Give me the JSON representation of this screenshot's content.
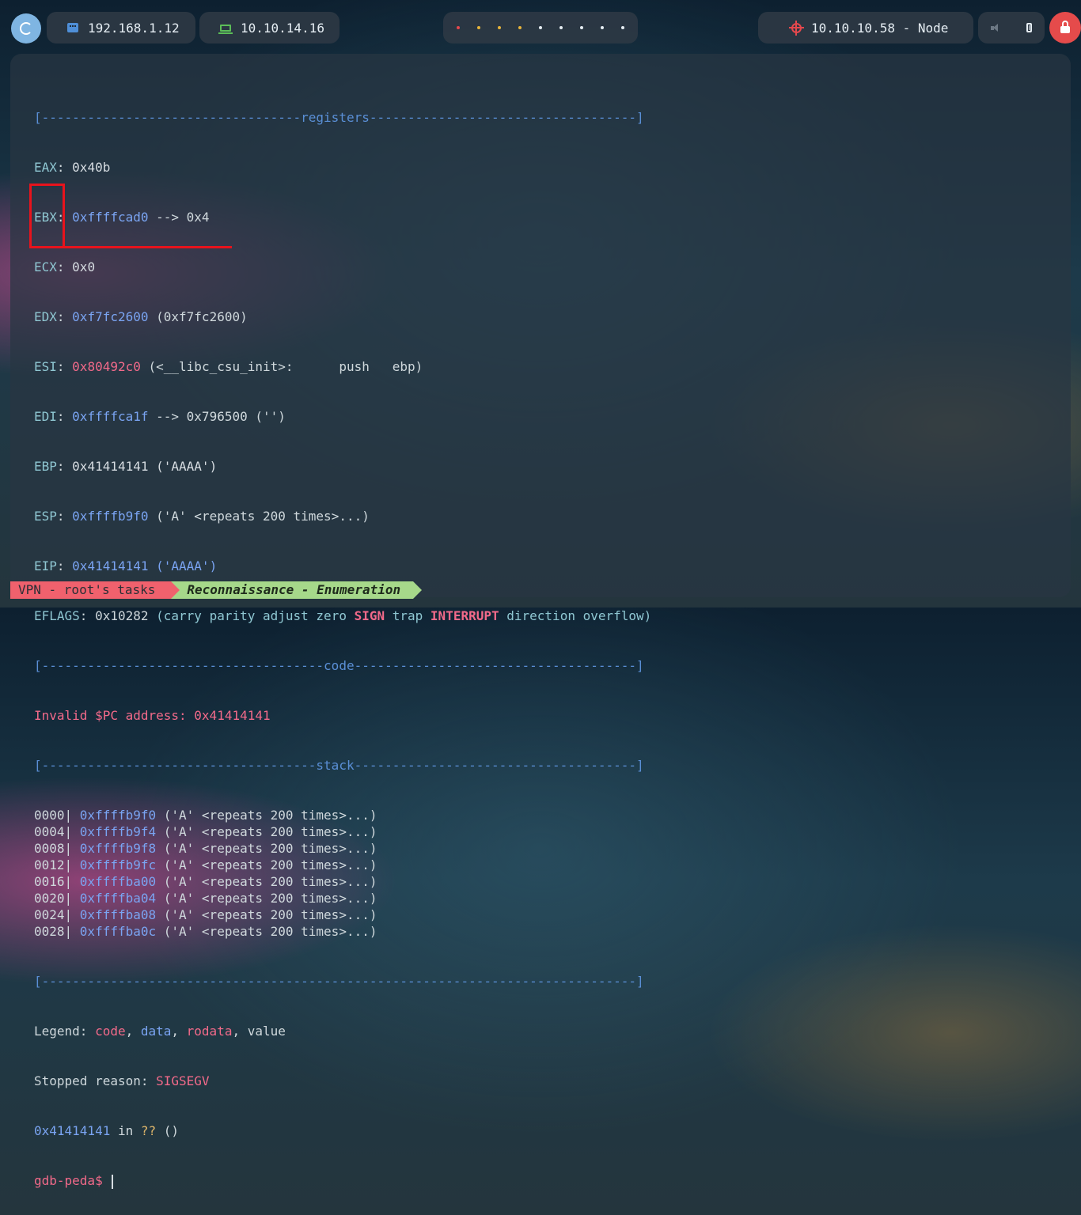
{
  "topbar": {
    "local_ip": "192.168.1.12",
    "vpn_ip": "10.10.14.16",
    "workspace_dot_colors": [
      "#e5484d",
      "#e8b43a",
      "#e8b43a",
      "#e8b43a",
      "#e6eef4",
      "#e6eef4",
      "#e6eef4",
      "#e6eef4",
      "#e6eef4"
    ],
    "target": "10.10.10.58 - Node",
    "icons": {
      "menu": "swirl-icon",
      "local": "network-card-icon",
      "vpn": "laptop-icon",
      "target": "crosshair-icon",
      "volume": "muted-speaker-icon",
      "battery": "battery-icon",
      "lock": "lock-icon"
    }
  },
  "terminal": {
    "sep_registers": "[----------------------------------registers-----------------------------------]",
    "eax": {
      "name": "EAX",
      "val": "0x40b"
    },
    "ebx": {
      "name": "EBX",
      "addr": "0xffffcad0",
      "rest": " --> 0x4"
    },
    "ecx": {
      "name": "ECX",
      "val": "0x0"
    },
    "edx": {
      "name": "EDX",
      "addr": "0xf7fc2600",
      "rest": " (0xf7fc2600)"
    },
    "esi": {
      "name": "ESI",
      "addr": "0x80492c0",
      "rest": " (<__libc_csu_init>:      push   ebp)"
    },
    "edi": {
      "name": "EDI",
      "addr": "0xffffca1f",
      "rest": " --> 0x796500 ('')"
    },
    "ebp": {
      "name": "EBP",
      "val": "0x41414141 ('AAAA')"
    },
    "esp": {
      "name": "ESP",
      "addr": "0xffffb9f0",
      "rest": " ('A' <repeats 200 times>...)"
    },
    "eip": {
      "name": "EIP",
      "addr": "0x41414141 ('AAAA')"
    },
    "eflags": {
      "name": "EFLAGS",
      "val": "0x10282",
      "p1": " (carry parity adjust zero ",
      "sign": "SIGN",
      "p2": " trap ",
      "interrupt": "INTERRUPT",
      "p3": " direction overflow)"
    },
    "sep_code": "[-------------------------------------code-------------------------------------]",
    "invalid_pc": "Invalid $PC address: 0x41414141",
    "sep_stack": "[------------------------------------stack-------------------------------------]",
    "stack": [
      {
        "off": "0000",
        "addr": "0xffffb9f0",
        "val": " ('A' <repeats 200 times>...)"
      },
      {
        "off": "0004",
        "addr": "0xffffb9f4",
        "val": " ('A' <repeats 200 times>...)"
      },
      {
        "off": "0008",
        "addr": "0xffffb9f8",
        "val": " ('A' <repeats 200 times>...)"
      },
      {
        "off": "0012",
        "addr": "0xffffb9fc",
        "val": " ('A' <repeats 200 times>...)"
      },
      {
        "off": "0016",
        "addr": "0xffffba00",
        "val": " ('A' <repeats 200 times>...)"
      },
      {
        "off": "0020",
        "addr": "0xffffba04",
        "val": " ('A' <repeats 200 times>...)"
      },
      {
        "off": "0024",
        "addr": "0xffffba08",
        "val": " ('A' <repeats 200 times>...)"
      },
      {
        "off": "0028",
        "addr": "0xffffba0c",
        "val": " ('A' <repeats 200 times>...)"
      }
    ],
    "sep_end": "[------------------------------------------------------------------------------]",
    "legend": {
      "label": "Legend: ",
      "code": "code",
      "c1": ", ",
      "data": "data",
      "c2": ", ",
      "rodata": "rodata",
      "c3": ", ",
      "value": "value"
    },
    "stopped": {
      "label": "Stopped reason: ",
      "reason": "SIGSEGV"
    },
    "frame": {
      "addr": "0x41414141",
      "mid": " in ",
      "q": "??",
      "end": " ()"
    },
    "prompt": "gdb-peda$ "
  },
  "statusbar": {
    "session": "VPN - root's tasks",
    "window": "Reconnaissance - Enumeration"
  },
  "colors": {
    "highlight": "#e8131c",
    "accent": "#7aa4f2",
    "error": "#f36a8a"
  }
}
